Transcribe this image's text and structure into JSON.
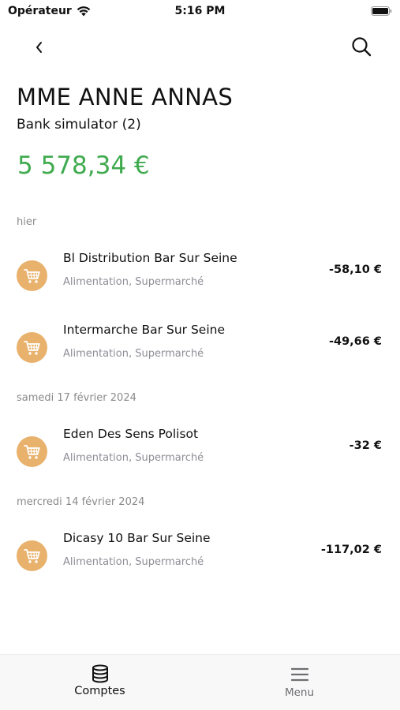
{
  "status_bar": {
    "carrier": "Opérateur",
    "time": "5:16 PM"
  },
  "account": {
    "holder": "MME ANNE ANNAS",
    "bank": "Bank simulator (2)",
    "balance": "5 578,34 €"
  },
  "transactions": [
    {
      "date": "hier",
      "items": [
        {
          "title": "Bl Distribution Bar Sur Seine",
          "category": "Alimentation, Supermarché",
          "amount": "-58,10 €",
          "icon": "shopping-cart-icon"
        },
        {
          "title": "Intermarche Bar Sur Seine",
          "category": "Alimentation, Supermarché",
          "amount": "-49,66 €",
          "icon": "shopping-cart-icon"
        }
      ]
    },
    {
      "date": "samedi 17 février 2024",
      "items": [
        {
          "title": "Eden Des Sens Polisot",
          "category": "Alimentation, Supermarché",
          "amount": "-32 €",
          "icon": "shopping-cart-icon"
        }
      ]
    },
    {
      "date": "mercredi 14 février 2024",
      "items": [
        {
          "title": "Dicasy 10 Bar Sur Seine",
          "category": "Alimentation, Supermarché",
          "amount": "-117,02 €",
          "icon": "shopping-cart-icon"
        }
      ]
    }
  ],
  "tab_bar": {
    "tabs": [
      {
        "label": "Comptes",
        "icon": "database-stack-icon",
        "active": true
      },
      {
        "label": "Menu",
        "icon": "hamburger-menu-icon",
        "active": false
      }
    ]
  },
  "colors": {
    "balance_positive": "#3faa4e",
    "category_icon_bg": "#e8b26d",
    "muted_text": "#8a8a8a",
    "tab_active": "#111111",
    "tab_inactive": "#6e6e73"
  }
}
